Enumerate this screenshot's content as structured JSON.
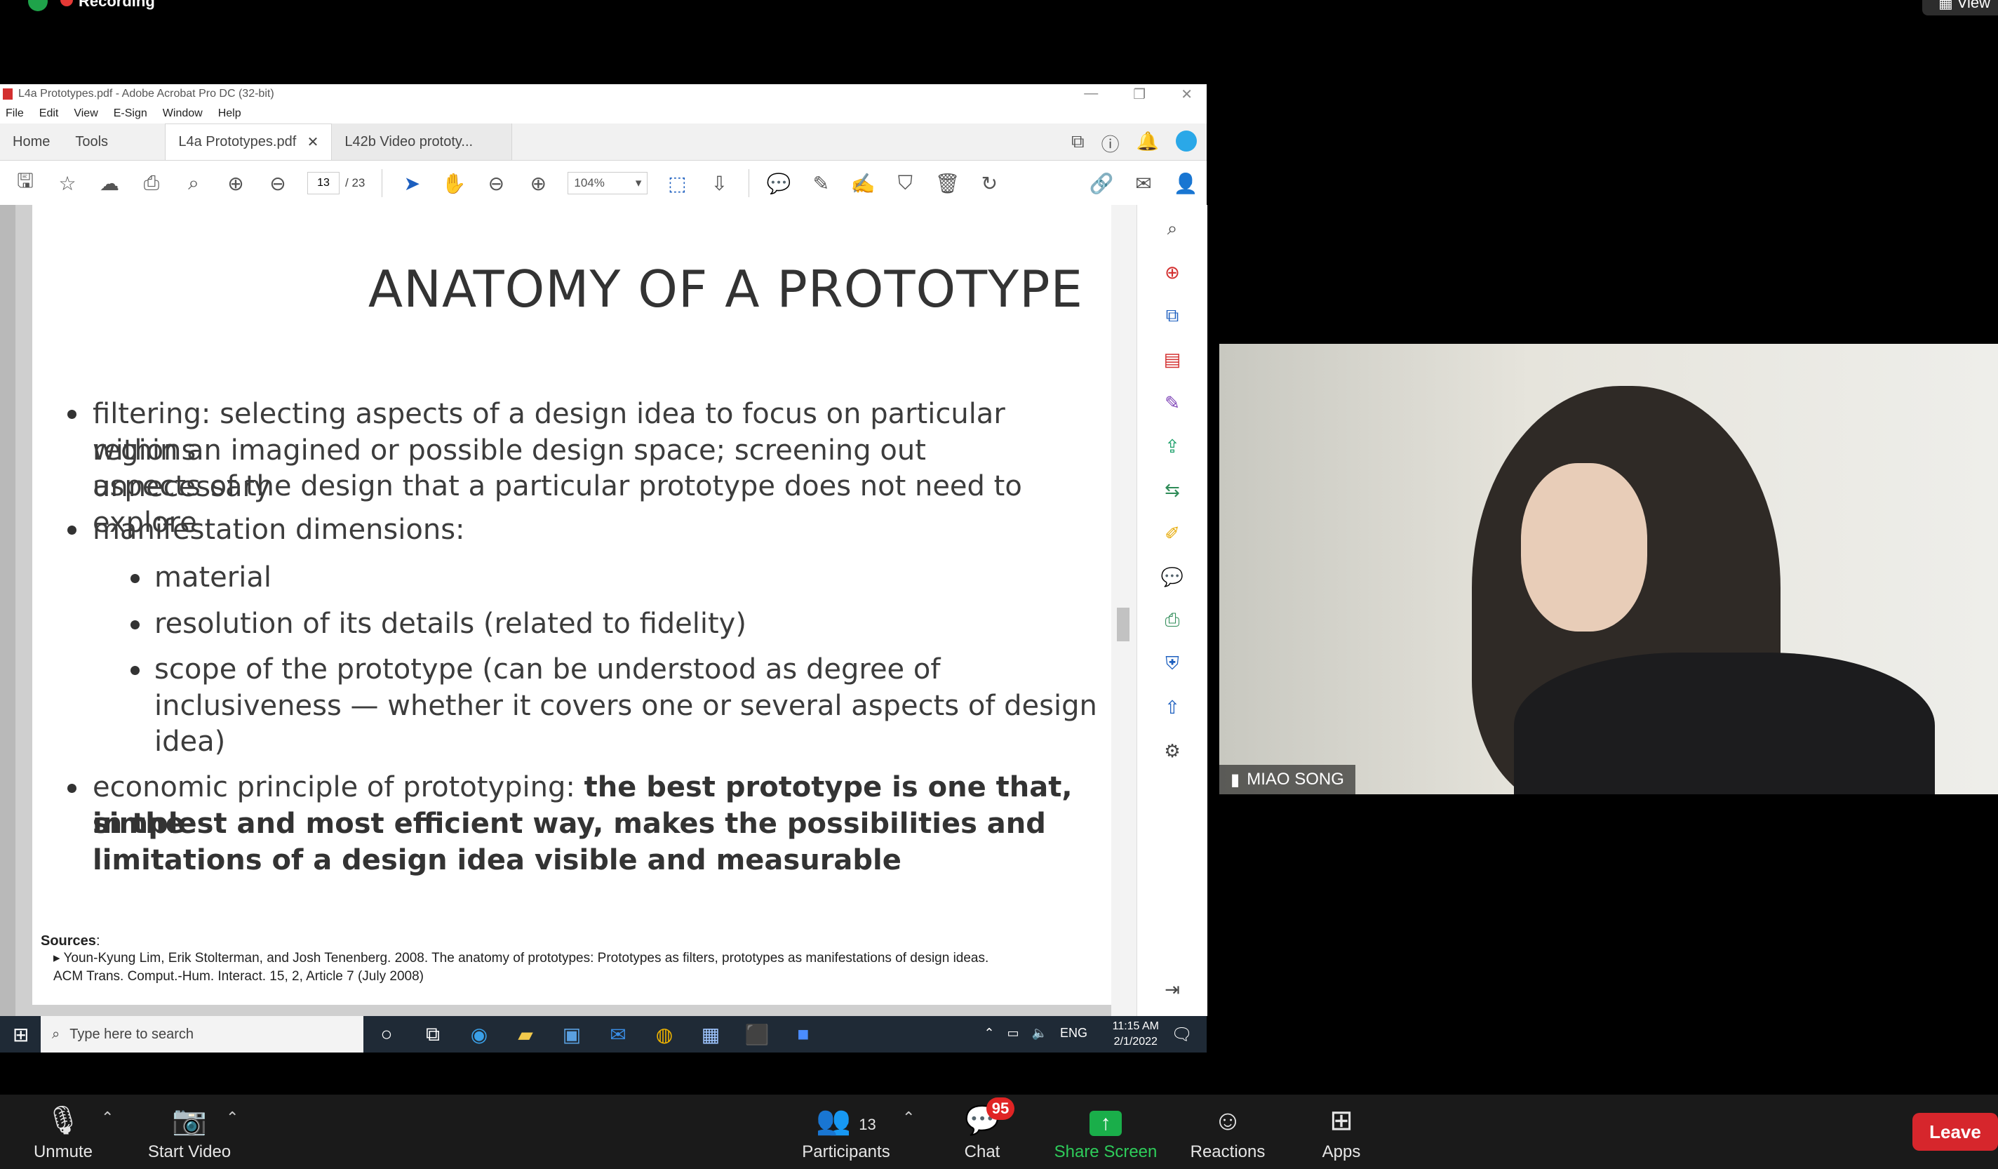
{
  "zoom_top": {
    "recording": "Recording",
    "view_button": "View"
  },
  "acrobat": {
    "window_title": "L4a Prototypes.pdf - Adobe Acrobat Pro DC (32-bit)",
    "menu": [
      "File",
      "Edit",
      "View",
      "E-Sign",
      "Window",
      "Help"
    ],
    "tabs": {
      "home": "Home",
      "tools": "Tools",
      "doc1": "L4a Prototypes.pdf",
      "doc2": "L42b Video prototy..."
    },
    "page_current": "13",
    "page_total": "/ 23",
    "zoom": "104%"
  },
  "slide": {
    "title": "ANATOMY OF A PROTOTYPE",
    "b1_l1": "filtering: selecting aspects of a design idea to focus on particular regions",
    "b1_l2": "within an imagined or possible design space; screening out unnecessary",
    "b1_l3": "aspects of the design that a particular prototype does not need to explore",
    "b2": "manifestation dimensions:",
    "s1": "material",
    "s2": "resolution of its details (related to fidelity)",
    "s3_l1": "scope of the prototype (can be understood as degree of",
    "s3_l2": "inclusiveness — whether it covers one or several aspects of design",
    "s3_l3": "idea)",
    "b3_prefix": "economic principle of prototyping: ",
    "b3_bold1": "the best prototype is one that, in the",
    "b3_bold2": "simplest and most efficient way, makes the possibilities and",
    "b3_bold3": "limitations of a design idea visible and measurable",
    "sources_label": "Sources",
    "ref_l1": "Youn-Kyung Lim, Erik Stolterman, and Josh Tenenberg. 2008. The anatomy of prototypes: Prototypes as filters, prototypes as manifestations of design ideas.",
    "ref_l2": "ACM Trans. Comput.-Hum. Interact. 15, 2, Article 7 (July 2008)"
  },
  "taskbar": {
    "search_placeholder": "Type here to search",
    "lang": "ENG",
    "time": "11:15 AM",
    "date": "2/1/2022"
  },
  "video": {
    "name": "MIAO SONG"
  },
  "zoom_bar": {
    "unmute": "Unmute",
    "start_video": "Start Video",
    "participants": "Participants",
    "participants_count": "13",
    "chat": "Chat",
    "chat_badge": "95",
    "share": "Share Screen",
    "reactions": "Reactions",
    "apps": "Apps",
    "leave": "Leave"
  },
  "colors": {
    "share_green": "#1aae4a",
    "leave_red": "#d6262c",
    "badge_red": "#e02424",
    "acrobat_red": "#d32f2f"
  }
}
